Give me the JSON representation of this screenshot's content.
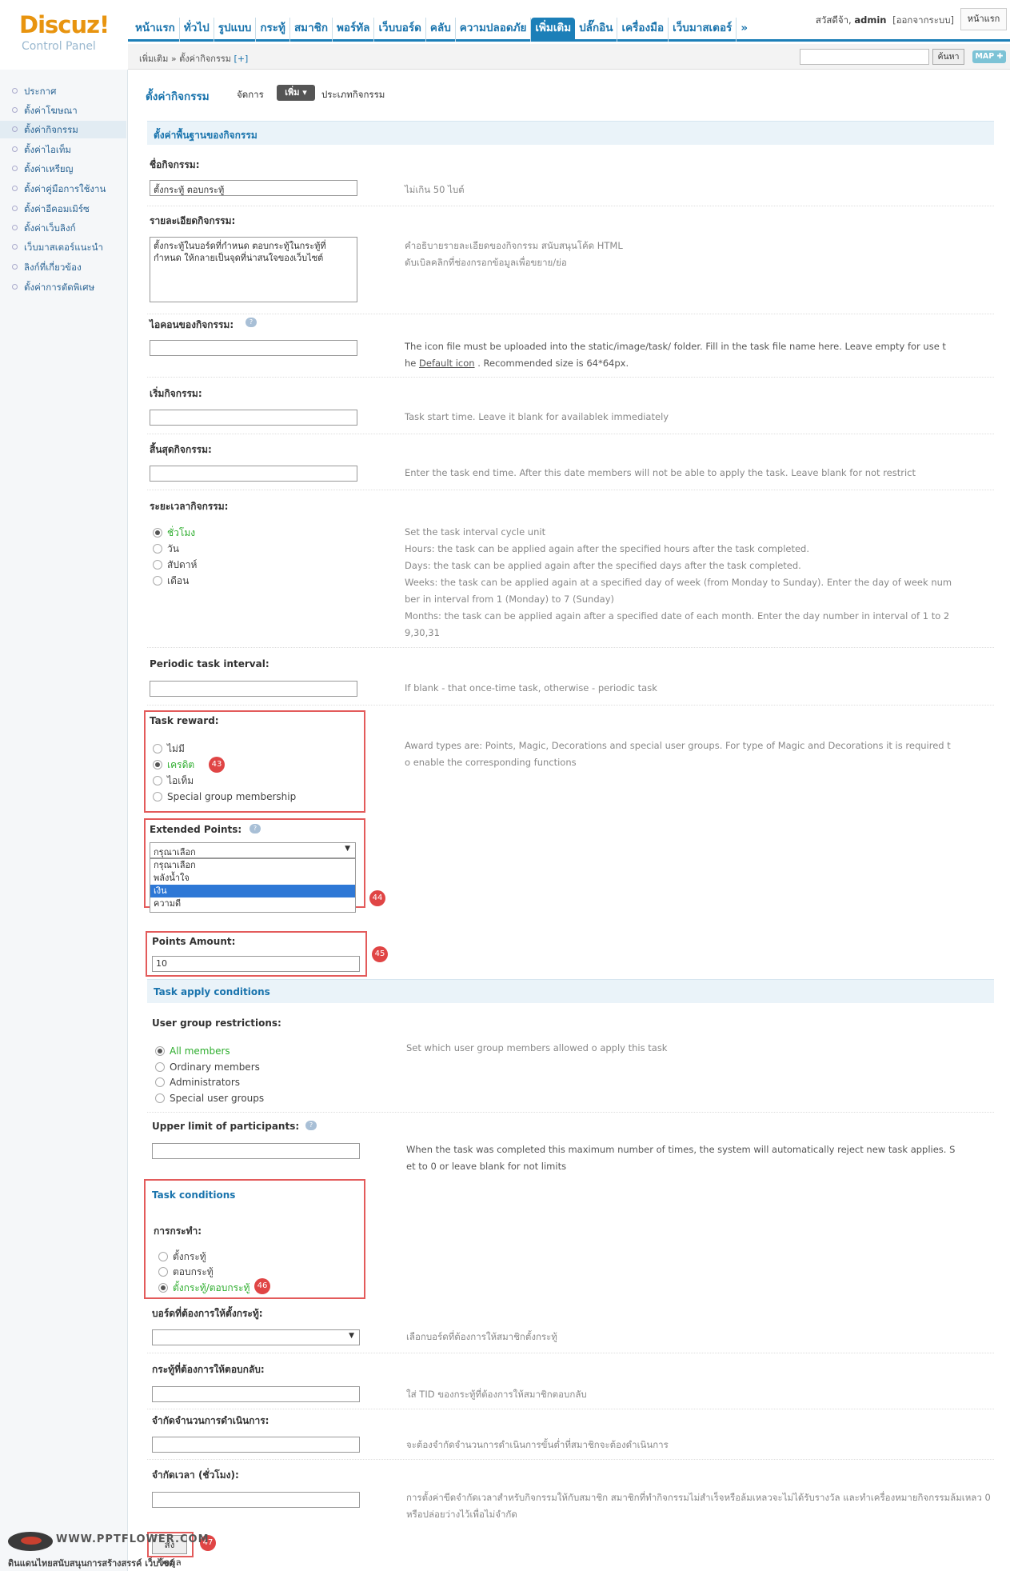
{
  "header": {
    "logo_main": "Discuz!",
    "logo_sub": "Control Panel",
    "nav": [
      "หน้าแรก",
      "ทั่วไป",
      "รูปแบบ",
      "กระทู้",
      "สมาชิก",
      "พอร์ทัล",
      "เว็บบอร์ด",
      "คลับ",
      "ความปลอดภัย",
      "เพิ่มเติม",
      "ปลั๊กอิน",
      "เครื่องมือ",
      "เว็บมาสเตอร์",
      "»"
    ],
    "greeting": "สวัสดีจ้า,",
    "user": "admin",
    "logout": "[ออกจากระบบ]",
    "home_button": "หน้าแรก",
    "breadcrumb": "เพิ่มเติม » ตั้งค่ากิจกรรม",
    "breadcrumb_add": "[+]",
    "search_button": "ค้นหา",
    "map_button": "MAP ✚"
  },
  "sidebar": [
    "ประกาศ",
    "ตั้งค่าโฆษณา",
    "ตั้งค่ากิจกรรม",
    "ตั้งค่าไอเท็ม",
    "ตั้งค่าเหรียญ",
    "ตั้งค่าคู่มือการใช้งาน",
    "ตั้งค่าอีคอมเมิร์ซ",
    "ตั้งค่าเว็บลิงก์",
    "เว็บมาสเตอร์แนะนำ",
    "ลิงก์ที่เกี่ยวข้อง",
    "ตั้งค่าการตัดพิเศษ"
  ],
  "page": {
    "title": "ตั้งค่ากิจกรรม",
    "manage": "จัดการ",
    "add": "เพิ่ม ▾",
    "type": "ประเภทกิจกรรม"
  },
  "basic": {
    "section": "ตั้งค่าพื้นฐานของกิจกรรม",
    "name_label": "ชื่อกิจกรรม:",
    "name_value": "ตั้งกระทู้ ตอบกระทู้",
    "name_help": "ไม่เกิน 50 ไบต์",
    "desc_label": "รายละเอียดกิจกรรม:",
    "desc_value": "ตั้งกระทู้ในบอร์ดที่กำหนด ตอบกระทู้ในกระทู้ที่กำหนด ให้กลายเป็นจุดที่น่าสนใจของเว็บไซต์",
    "desc_help1": "คำอธิบายรายละเอียดของกิจกรรม สนับสนุนโค้ด HTML",
    "desc_help2": "ดับเบิลคลิกที่ช่องกรอกข้อมูลเพื่อขยาย/ย่อ",
    "icon_label": "ไอคอนของกิจกรรม:",
    "icon_help1": "The icon file must be uploaded into the static/image/task/ folder. Fill in the task file name here. Leave empty for use t",
    "icon_help2a": "he",
    "icon_help2_link": "Default icon",
    "icon_help2b": ". Recommended size is 64*64px.",
    "start_label": "เริ่มกิจกรรม:",
    "start_help": "Task start time. Leave it blank for availablek immediately",
    "end_label": "สิ้นสุดกิจกรรม:",
    "end_help": "Enter the task end time. After this date members will not be able to apply the task. Leave blank for not restrict",
    "period_label": "ระยะเวลากิจกรรม:",
    "period_options": [
      "ชั่วโมง",
      "วัน",
      "สัปดาห์",
      "เดือน"
    ],
    "period_help": [
      "Set the task interval cycle unit",
      "Hours: the task can be applied again after the specified hours after the task completed.",
      "Days: the task can be applied again after the specified days after the task completed.",
      "Weeks: the task can be applied again at a specified day of week (from Monday to Sunday). Enter the day of week num",
      "ber in interval from 1 (Monday) to 7 (Sunday)",
      "Months: the task can be applied again after a specified date of each month. Enter the day number in interval of 1 to 2",
      "9,30,31"
    ],
    "interval_label": "Periodic task interval:",
    "interval_help": "If blank - that once-time task, otherwise - periodic task",
    "reward_label": "Task reward:",
    "reward_options": [
      "ไม่มี",
      "เครดิต",
      "ไอเท็ม",
      "Special group membership"
    ],
    "reward_help1": "Award types are: Points, Magic, Decorations and special user groups. For type of Magic and Decorations it is required t",
    "reward_help2": "o enable the corresponding functions",
    "ext_label": "Extended Points:",
    "ext_selected": "กรุณาเลือก",
    "ext_options": [
      "กรุณาเลือก",
      "พลังน้ำใจ",
      "เงิน",
      "ความดี"
    ],
    "amount_label": "Points Amount:",
    "amount_value": "10"
  },
  "apply": {
    "section": "Task apply conditions",
    "group_label": "User group restrictions:",
    "group_options": [
      "All members",
      "Ordinary members",
      "Administrators",
      "Special user groups"
    ],
    "group_help": "Set which user group members allowed o apply this task",
    "limit_label": "Upper limit of participants:",
    "limit_help1": "When the task was completed this maximum number of times, the system will automatically reject new task applies. S",
    "limit_help2": "et to 0 or leave blank for not limits"
  },
  "cond": {
    "section": "Task conditions",
    "action_label": "การกระทำ:",
    "action_options": [
      "ตั้งกระทู้",
      "ตอบกระทู้",
      "ตั้งกระทู้/ตอบกระทู้"
    ],
    "forum_label": "บอร์ดที่ต้องการให้ตั้งกระทู้:",
    "forum_help": "เลือกบอร์ดที่ต้องการให้สมาชิกตั้งกระทู้",
    "thread_label": "กระทู้ที่ต้องการให้ตอบกลับ:",
    "thread_help": "ใส่ TID ของกระทู้ที่ต้องการให้สมาชิกตอบกลับ",
    "count_label": "จำกัดจำนวนการดำเนินการ:",
    "count_help": "จะต้องจำกัดจำนวนการดำเนินการขั้นต่ำที่สมาชิกจะต้องดำเนินการ",
    "time_label": "จำกัดเวลา (ชั่วโมง):",
    "time_help1": "การตั้งค่าขีดจำกัดเวลาสำหรับกิจกรรมให้กับสมาชิก สมาชิกที่ทำกิจกรรมไม่สำเร็จหรือล้มเหลวจะไม่ได้รับรางวัล และทำเครื่องหมายกิจกรรมล้มเหลว 0",
    "time_help2": "หรือปล่อยว่างไว้เพื่อไม่จำกัด",
    "submit": "ส่งข้อมูล"
  },
  "badges": [
    "43",
    "44",
    "45",
    "46",
    "47"
  ],
  "watermark": {
    "site": "WWW.PPTFLOWER.COM",
    "caption": "ดินแดนไทยสนับสนุนการสร้างสรรค์ เว็บไซต์"
  },
  "colors": {
    "accent": "#1c7fb8",
    "highlight": "#e35b5b",
    "selected": "#2fae2f"
  }
}
